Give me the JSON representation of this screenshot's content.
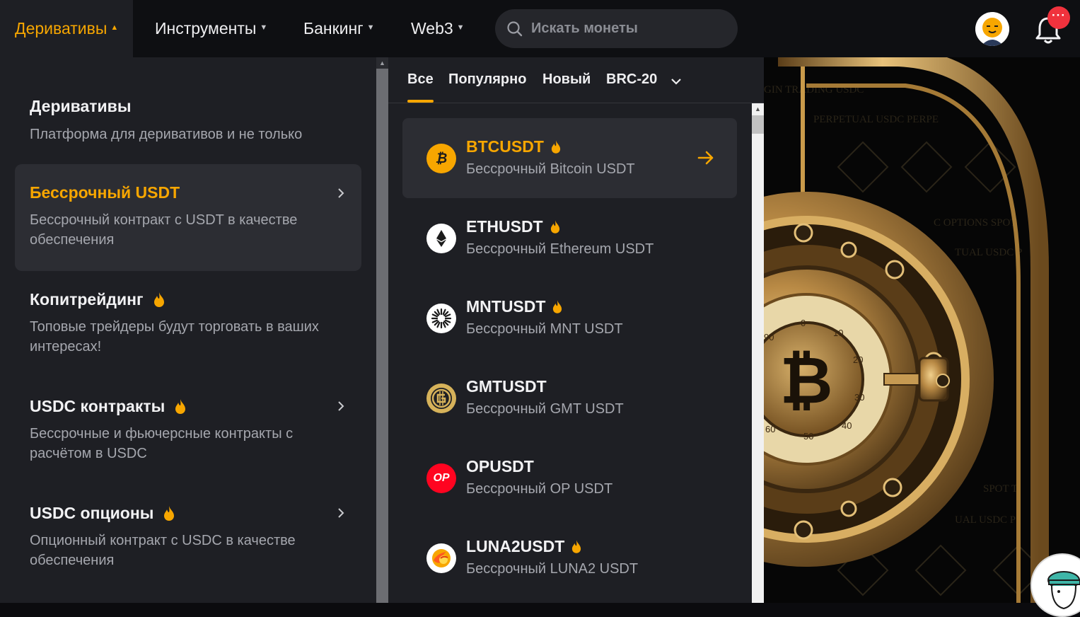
{
  "header": {
    "nav": [
      {
        "label": "Деривативы",
        "active": true
      },
      {
        "label": "Инструменты",
        "active": false
      },
      {
        "label": "Банкинг",
        "active": false
      },
      {
        "label": "Web3",
        "active": false
      }
    ],
    "search_placeholder": "Искать монеты",
    "notification_badge": "···"
  },
  "left_panel": {
    "title": "Деривативы",
    "subtitle": "Платформа для деривативов и не только",
    "items": [
      {
        "title": "Бессрочный USDT",
        "desc": "Бессрочный контракт с USDT в качестве обеспечения",
        "active": true,
        "hot": false,
        "has_arrow": true
      },
      {
        "title": "Копитрейдинг",
        "desc": "Топовые трейдеры будут торговать в ваших интересах!",
        "active": false,
        "hot": true,
        "has_arrow": false
      },
      {
        "title": "USDC контракты",
        "desc": "Бессрочные и фьючерсные контракты с расчётом в USDC",
        "active": false,
        "hot": true,
        "has_arrow": true
      },
      {
        "title": "USDC опционы",
        "desc": "Опционный контракт с USDC в качестве обеспечения",
        "active": false,
        "hot": true,
        "has_arrow": true
      }
    ]
  },
  "middle_panel": {
    "tabs": [
      {
        "label": "Все",
        "active": true
      },
      {
        "label": "Популярно",
        "active": false
      },
      {
        "label": "Новый",
        "active": false
      },
      {
        "label": "BRC-20",
        "active": false
      }
    ],
    "coins": [
      {
        "symbol": "BTCUSDT",
        "desc": "Бессрочный Bitcoin USDT",
        "hot": true,
        "active": true,
        "icon": "bitcoin-icon",
        "icon_color": "#f7a600"
      },
      {
        "symbol": "ETHUSDT",
        "desc": "Бессрочный Ethereum USDT",
        "hot": true,
        "active": false,
        "icon": "ethereum-icon",
        "icon_color": "#ffffff"
      },
      {
        "symbol": "MNTUSDT",
        "desc": "Бессрочный MNT USDT",
        "hot": true,
        "active": false,
        "icon": "mantle-icon",
        "icon_color": "#ffffff"
      },
      {
        "symbol": "GMTUSDT",
        "desc": "Бессрочный GMT USDT",
        "hot": false,
        "active": false,
        "icon": "gmt-icon",
        "icon_color": "#d6b25a"
      },
      {
        "symbol": "OPUSDT",
        "desc": "Бессрочный OP USDT",
        "hot": false,
        "active": false,
        "icon": "optimism-icon",
        "icon_color": "#ff0420",
        "icon_text": "OP"
      },
      {
        "symbol": "LUNA2USDT",
        "desc": "Бессрочный LUNA2 USDT",
        "hot": true,
        "active": false,
        "icon": "luna-icon",
        "icon_color": "#ffffff"
      }
    ]
  },
  "banner": {
    "image": "bitcoin-vault-illustration",
    "bg_texts": [
      "GIN TRADING USDC",
      "PERPETUAL USDC PERPE",
      "C OPTIONS SPOT",
      "TUAL USDC P",
      "SPOT T",
      "UAL USDC P"
    ],
    "dial_numbers": [
      "0",
      "10",
      "20",
      "30",
      "40",
      "50",
      "60",
      "90"
    ]
  },
  "colors": {
    "accent": "#f7a600",
    "panel": "#1e1f24",
    "topbar": "#0e0f12",
    "active_row": "#2c2d33"
  }
}
